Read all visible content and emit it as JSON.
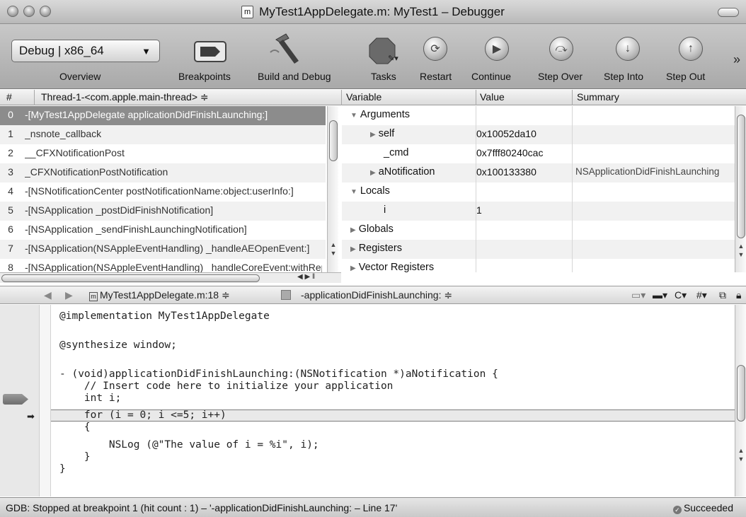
{
  "window": {
    "title": "MyTest1AppDelegate.m: MyTest1 – Debugger",
    "file_badge": "m"
  },
  "toolbar": {
    "scheme": "Debug | x86_64",
    "items": [
      {
        "label": "Overview"
      },
      {
        "label": "Breakpoints"
      },
      {
        "label": "Build and Debug"
      },
      {
        "label": "Tasks"
      },
      {
        "label": "Restart"
      },
      {
        "label": "Continue"
      },
      {
        "label": "Step Over"
      },
      {
        "label": "Step Into"
      },
      {
        "label": "Step Out"
      }
    ],
    "overflow": "»"
  },
  "threads": {
    "col_num": "#",
    "col_thread": "Thread-1-<com.apple.main-thread> ≑",
    "rows": [
      {
        "idx": "0",
        "fn": "-[MyTest1AppDelegate applicationDidFinishLaunching:]"
      },
      {
        "idx": "1",
        "fn": "_nsnote_callback"
      },
      {
        "idx": "2",
        "fn": "__CFXNotificationPost"
      },
      {
        "idx": "3",
        "fn": "_CFXNotificationPostNotification"
      },
      {
        "idx": "4",
        "fn": "-[NSNotificationCenter postNotificationName:object:userInfo:]"
      },
      {
        "idx": "5",
        "fn": "-[NSApplication _postDidFinishNotification]"
      },
      {
        "idx": "6",
        "fn": "-[NSApplication _sendFinishLaunchingNotification]"
      },
      {
        "idx": "7",
        "fn": "-[NSApplication(NSAppleEventHandling) _handleAEOpenEvent:]"
      },
      {
        "idx": "8",
        "fn": "-[NSApplication(NSAppleEventHandling) _handleCoreEvent:withReplyEvent:]"
      }
    ]
  },
  "variables": {
    "col_variable": "Variable",
    "col_value": "Value",
    "col_summary": "Summary",
    "rows": [
      {
        "name": "Arguments",
        "value": "",
        "summary": "",
        "tri": "▼"
      },
      {
        "name": "self",
        "value": "0x10052da10",
        "summary": "",
        "tri": "▶"
      },
      {
        "name": "_cmd",
        "value": "0x7fff80240cac",
        "summary": "",
        "tri": ""
      },
      {
        "name": "aNotification",
        "value": "0x100133380",
        "summary": "NSApplicationDidFinishLaunching",
        "tri": "▶"
      },
      {
        "name": "Locals",
        "value": "",
        "summary": "",
        "tri": "▼"
      },
      {
        "name": "i",
        "value": "1",
        "summary": "",
        "tri": ""
      },
      {
        "name": "Globals",
        "value": "",
        "summary": "",
        "tri": "▶"
      },
      {
        "name": "Registers",
        "value": "",
        "summary": "",
        "tri": "▶"
      },
      {
        "name": "Vector Registers",
        "value": "",
        "summary": "",
        "tri": "▶"
      }
    ]
  },
  "navigator": {
    "back": "◀",
    "forward": "▶",
    "file": "MyTest1AppDelegate.m:18 ≑",
    "symbol": "-applicationDidFinishLaunching: ≑",
    "right_c": "C",
    "right_hash": "#"
  },
  "code": {
    "lines": [
      "@implementation MyTest1AppDelegate",
      "",
      "@synthesize window;",
      "",
      "- (void)applicationDidFinishLaunching:(NSNotification *)aNotification {",
      "    // Insert code here to initialize your application",
      "    int i;",
      "    for (i = 0; i <=5; i++)",
      "    {",
      "        NSLog (@\"The value of i = %i\", i);",
      "    }",
      "}"
    ]
  },
  "status": {
    "message": "GDB: Stopped at breakpoint 1 (hit count : 1) – '-applicationDidFinishLaunching: – Line 17'",
    "result": "Succeeded"
  }
}
